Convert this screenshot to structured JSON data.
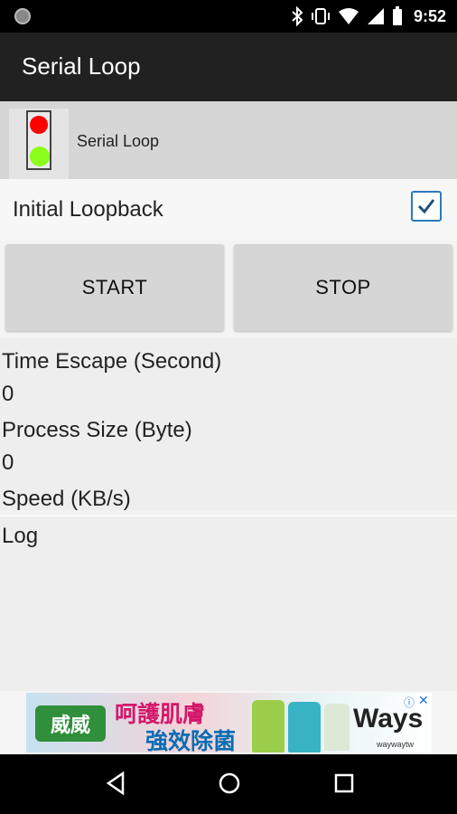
{
  "status_bar": {
    "time": "9:52",
    "icons": [
      "notification-dot-icon",
      "bluetooth-icon",
      "vibrate-icon",
      "wifi-icon",
      "signal-icon",
      "battery-icon"
    ]
  },
  "app_bar": {
    "title": "Serial Loop"
  },
  "device": {
    "name": "Serial Loop",
    "light_colors": {
      "top": "#ff0000",
      "bottom": "#8bff1a"
    }
  },
  "loopback": {
    "label": "Initial Loopback",
    "checked": true
  },
  "buttons": {
    "start": "START",
    "stop": "STOP"
  },
  "stats": {
    "time_label": "Time Escape (Second)",
    "time_value": "0",
    "size_label": "Process Size (Byte)",
    "size_value": "0",
    "speed_label": "Speed (KB/s)"
  },
  "log": {
    "label": "Log"
  },
  "ad": {
    "logo_text": "威威",
    "line1": "呵護肌膚",
    "line2": "強效除菌",
    "brand": "Ways",
    "sub": "waywaytw",
    "info_icon": "ⓘ",
    "close_icon": "✕"
  },
  "nav": {
    "icons": [
      "back-icon",
      "home-icon",
      "recents-icon"
    ]
  }
}
